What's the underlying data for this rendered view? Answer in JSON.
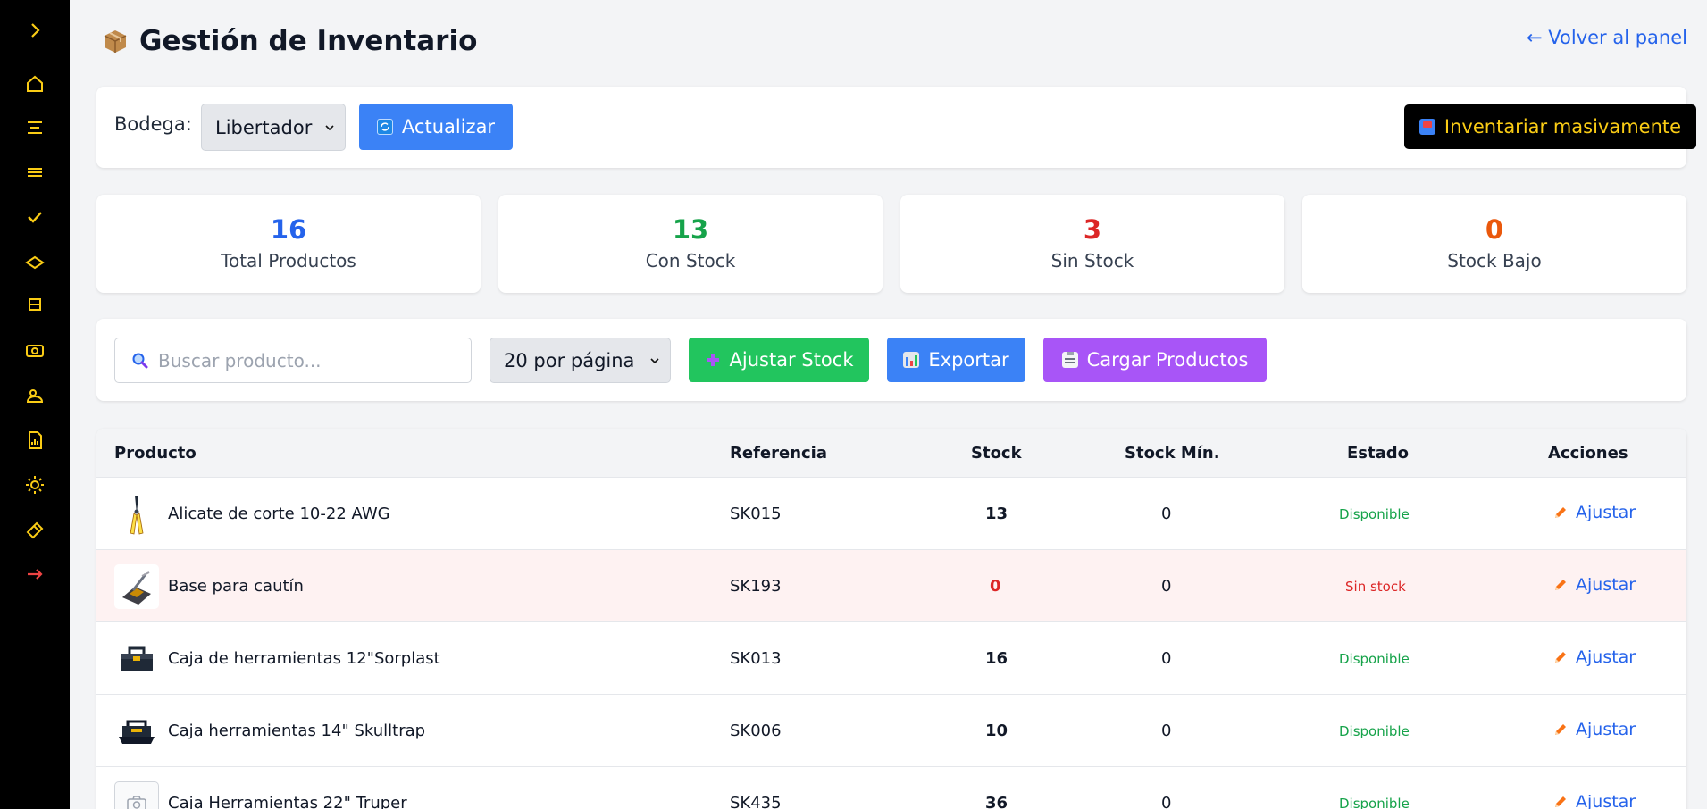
{
  "header": {
    "title": "Gestión de Inventario",
    "title_icon": "package-icon",
    "back_link": "← Volver al panel"
  },
  "sidebar": {
    "items": [
      {
        "name": "expand-icon"
      },
      {
        "name": "home-icon"
      },
      {
        "name": "align-center-icon"
      },
      {
        "name": "menu-icon"
      },
      {
        "name": "check-icon"
      },
      {
        "name": "diamond-icon"
      },
      {
        "name": "cart-icon"
      },
      {
        "name": "cash-icon"
      },
      {
        "name": "user-icon"
      },
      {
        "name": "report-icon"
      },
      {
        "name": "sun-icon"
      },
      {
        "name": "tool-icon"
      },
      {
        "name": "logout-icon"
      }
    ],
    "accent": "#facc15",
    "logout_color": "#ef4444"
  },
  "toolbar": {
    "bodega_label": "Bodega:",
    "bodega_value": "Libertador",
    "refresh_label": "Actualizar",
    "bulk_label": "Inventariar masivamente"
  },
  "stats": [
    {
      "value": "16",
      "label": "Total Productos",
      "color": "#2563eb"
    },
    {
      "value": "13",
      "label": "Con Stock",
      "color": "#16a34a"
    },
    {
      "value": "3",
      "label": "Sin Stock",
      "color": "#dc2626"
    },
    {
      "value": "0",
      "label": "Stock Bajo",
      "color": "#ea580c"
    }
  ],
  "filters": {
    "search_placeholder": "Buscar producto...",
    "per_page": "20 por página",
    "adjust_label": "Ajustar Stock",
    "export_label": "Exportar",
    "load_label": "Cargar Productos"
  },
  "table": {
    "headers": [
      "Producto",
      "Referencia",
      "Stock",
      "Stock Mín.",
      "Estado",
      "Acciones"
    ],
    "rows": [
      {
        "product": "Alicate de corte 10-22 AWG",
        "ref": "SK015",
        "stock": "13",
        "min": "0",
        "status": "Disponible",
        "action": "Ajustar",
        "thumb": "pliers-image"
      },
      {
        "product": "Base para cautín",
        "ref": "SK193",
        "stock": "0",
        "min": "0",
        "status": "Sin stock",
        "action": "Ajustar",
        "thumb": "soldering-stand-image"
      },
      {
        "product": "Caja de herramientas 12\"Sorplast",
        "ref": "SK013",
        "stock": "16",
        "min": "0",
        "status": "Disponible",
        "action": "Ajustar",
        "thumb": "toolbox-image"
      },
      {
        "product": "Caja herramientas 14\" Skulltrap",
        "ref": "SK006",
        "stock": "10",
        "min": "0",
        "status": "Disponible",
        "action": "Ajustar",
        "thumb": "toolbox-image"
      },
      {
        "product": "Caja Herramientas 22\" Truper",
        "ref": "SK435",
        "stock": "36",
        "min": "0",
        "status": "Disponible",
        "action": "Ajustar",
        "thumb": "camera-placeholder-icon"
      }
    ]
  }
}
